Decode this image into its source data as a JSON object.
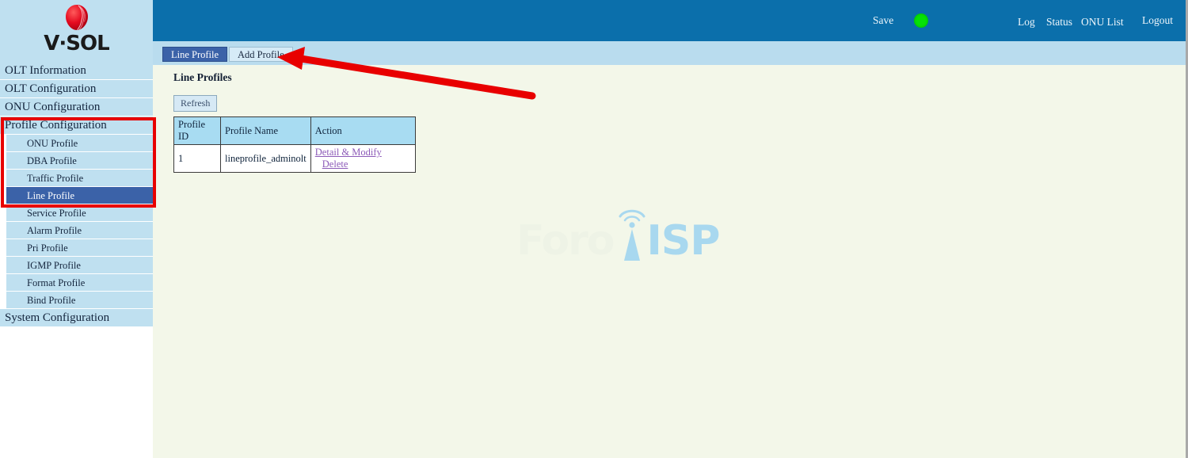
{
  "brand": {
    "name": "V·SOL",
    "logo_icon": "red-sphere-logo-icon"
  },
  "header": {
    "save_label": "Save",
    "status_indicator": "green-status-dot",
    "status_color": "#06e206",
    "background_color": "#0b6fab",
    "links": {
      "log": "Log",
      "status": "Status",
      "onu_list": "ONU List",
      "logout": "Logout"
    }
  },
  "sidebar": {
    "background_color": "#bfe0f0",
    "selected_color": "#3b62a8",
    "items": [
      {
        "label": "OLT Information",
        "level": "top",
        "selected": false
      },
      {
        "label": "OLT Configuration",
        "level": "top",
        "selected": false
      },
      {
        "label": "ONU Configuration",
        "level": "top",
        "selected": false
      },
      {
        "label": "Profile Configuration",
        "level": "top",
        "selected": false
      },
      {
        "label": "ONU Profile",
        "level": "sub",
        "selected": false
      },
      {
        "label": "DBA Profile",
        "level": "sub",
        "selected": false
      },
      {
        "label": "Traffic Profile",
        "level": "sub",
        "selected": false
      },
      {
        "label": "Line Profile",
        "level": "sub",
        "selected": true
      },
      {
        "label": "Service Profile",
        "level": "sub",
        "selected": false
      },
      {
        "label": "Alarm Profile",
        "level": "sub",
        "selected": false
      },
      {
        "label": "Pri Profile",
        "level": "sub",
        "selected": false
      },
      {
        "label": "IGMP Profile",
        "level": "sub",
        "selected": false
      },
      {
        "label": "Format Profile",
        "level": "sub",
        "selected": false
      },
      {
        "label": "Bind Profile",
        "level": "sub",
        "selected": false
      },
      {
        "label": "System Configuration",
        "level": "top",
        "selected": false
      }
    ]
  },
  "tabs": [
    {
      "label": "Line Profile",
      "active": true
    },
    {
      "label": "Add Profile",
      "active": false
    }
  ],
  "main": {
    "title": "Line Profiles",
    "refresh_label": "Refresh",
    "table": {
      "columns": [
        "Profile ID",
        "Profile Name",
        "Action"
      ],
      "rows": [
        {
          "profile_id": "1",
          "profile_name": "lineprofile_adminolt",
          "actions": [
            "Detail & Modify",
            "Delete"
          ]
        }
      ]
    },
    "background_color": "#f3f7e9"
  },
  "watermark": {
    "text_left": "Foro",
    "text_right": "ISP",
    "icon": "wifi-tower-icon"
  },
  "annotations": {
    "highlight_color": "#e80000",
    "box_target": "Profile Configuration menu group",
    "arrow_target": "Add Profile tab"
  }
}
